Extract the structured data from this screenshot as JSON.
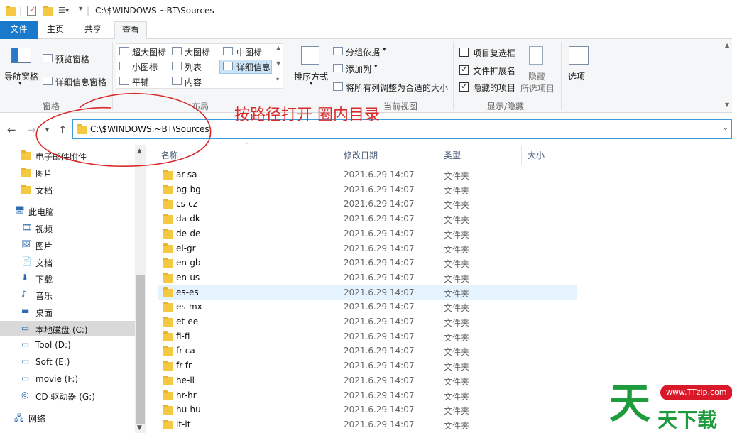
{
  "titlebar": {
    "path": "C:\\$WINDOWS.~BT\\Sources"
  },
  "tabs": {
    "file": "文件",
    "home": "主页",
    "share": "共享",
    "view": "查看"
  },
  "ribbon": {
    "panes": {
      "nav_pane": "导航窗格",
      "preview": "预览窗格",
      "details": "详细信息窗格",
      "label": "窗格"
    },
    "layout": {
      "xl_icons": "超大图标",
      "l_icons": "大图标",
      "m_icons": "中图标",
      "s_icons": "小图标",
      "list": "列表",
      "details": "详细信息",
      "tiles": "平铺",
      "content": "内容",
      "label": "布局"
    },
    "current_view": {
      "sort": "排序方式",
      "group": "分组依据",
      "add_col": "添加列",
      "fit_cols": "将所有列调整为合适的大小",
      "label": "当前视图"
    },
    "show_hide": {
      "item_checkboxes": "项目复选框",
      "extensions": "文件扩展名",
      "hidden_items": "隐藏的项目",
      "hide": "隐藏",
      "hide_selected": "所选项目",
      "label": "显示/隐藏",
      "checks": [
        false,
        true,
        true
      ]
    },
    "options": "选项"
  },
  "address": {
    "path": "C:\\$WINDOWS.~BT\\Sources"
  },
  "annotation": "按路径打开 圈内目录",
  "nav": [
    {
      "label": "电子邮件附件",
      "icon": "folder-icon"
    },
    {
      "label": "图片",
      "icon": "folder-icon"
    },
    {
      "label": "文档",
      "icon": "folder-icon"
    },
    {
      "label": "此电脑",
      "icon": "computer-icon"
    },
    {
      "label": "视频",
      "icon": "video-icon"
    },
    {
      "label": "图片",
      "icon": "pictures-icon"
    },
    {
      "label": "文档",
      "icon": "documents-icon"
    },
    {
      "label": "下载",
      "icon": "download-icon"
    },
    {
      "label": "音乐",
      "icon": "music-icon"
    },
    {
      "label": "桌面",
      "icon": "desktop-icon"
    },
    {
      "label": "本地磁盘 (C:)",
      "icon": "drive-icon"
    },
    {
      "label": "Tool (D:)",
      "icon": "drive-icon"
    },
    {
      "label": "Soft (E:)",
      "icon": "drive-icon"
    },
    {
      "label": "movie (F:)",
      "icon": "drive-icon"
    },
    {
      "label": "CD 驱动器 (G:)",
      "icon": "cd-drive-icon"
    },
    {
      "label": "网络",
      "icon": "network-icon"
    }
  ],
  "columns": {
    "name": "名称",
    "date": "修改日期",
    "type": "类型",
    "size": "大小"
  },
  "files": [
    {
      "name": "ar-sa",
      "date": "2021.6.29 14:07",
      "type": "文件夹"
    },
    {
      "name": "bg-bg",
      "date": "2021.6.29 14:07",
      "type": "文件夹"
    },
    {
      "name": "cs-cz",
      "date": "2021.6.29 14:07",
      "type": "文件夹"
    },
    {
      "name": "da-dk",
      "date": "2021.6.29 14:07",
      "type": "文件夹"
    },
    {
      "name": "de-de",
      "date": "2021.6.29 14:07",
      "type": "文件夹"
    },
    {
      "name": "el-gr",
      "date": "2021.6.29 14:07",
      "type": "文件夹"
    },
    {
      "name": "en-gb",
      "date": "2021.6.29 14:07",
      "type": "文件夹"
    },
    {
      "name": "en-us",
      "date": "2021.6.29 14:07",
      "type": "文件夹"
    },
    {
      "name": "es-es",
      "date": "2021.6.29 14:07",
      "type": "文件夹"
    },
    {
      "name": "es-mx",
      "date": "2021.6.29 14:07",
      "type": "文件夹"
    },
    {
      "name": "et-ee",
      "date": "2021.6.29 14:07",
      "type": "文件夹"
    },
    {
      "name": "fi-fi",
      "date": "2021.6.29 14:07",
      "type": "文件夹"
    },
    {
      "name": "fr-ca",
      "date": "2021.6.29 14:07",
      "type": "文件夹"
    },
    {
      "name": "fr-fr",
      "date": "2021.6.29 14:07",
      "type": "文件夹"
    },
    {
      "name": "he-il",
      "date": "2021.6.29 14:07",
      "type": "文件夹"
    },
    {
      "name": "hr-hr",
      "date": "2021.6.29 14:07",
      "type": "文件夹"
    },
    {
      "name": "hu-hu",
      "date": "2021.6.29 14:07",
      "type": "文件夹"
    },
    {
      "name": "it-it",
      "date": "2021.6.29 14:07",
      "type": "文件夹"
    }
  ],
  "highlighted_row": 8,
  "watermark": {
    "url": "www.TTzip.com",
    "big": "天",
    "small": "天下载"
  },
  "colors": {
    "accent": "#1979ca",
    "annotation": "#d92b2b",
    "folder": "#f5c842",
    "watermark_green": "#1e9b3c"
  }
}
